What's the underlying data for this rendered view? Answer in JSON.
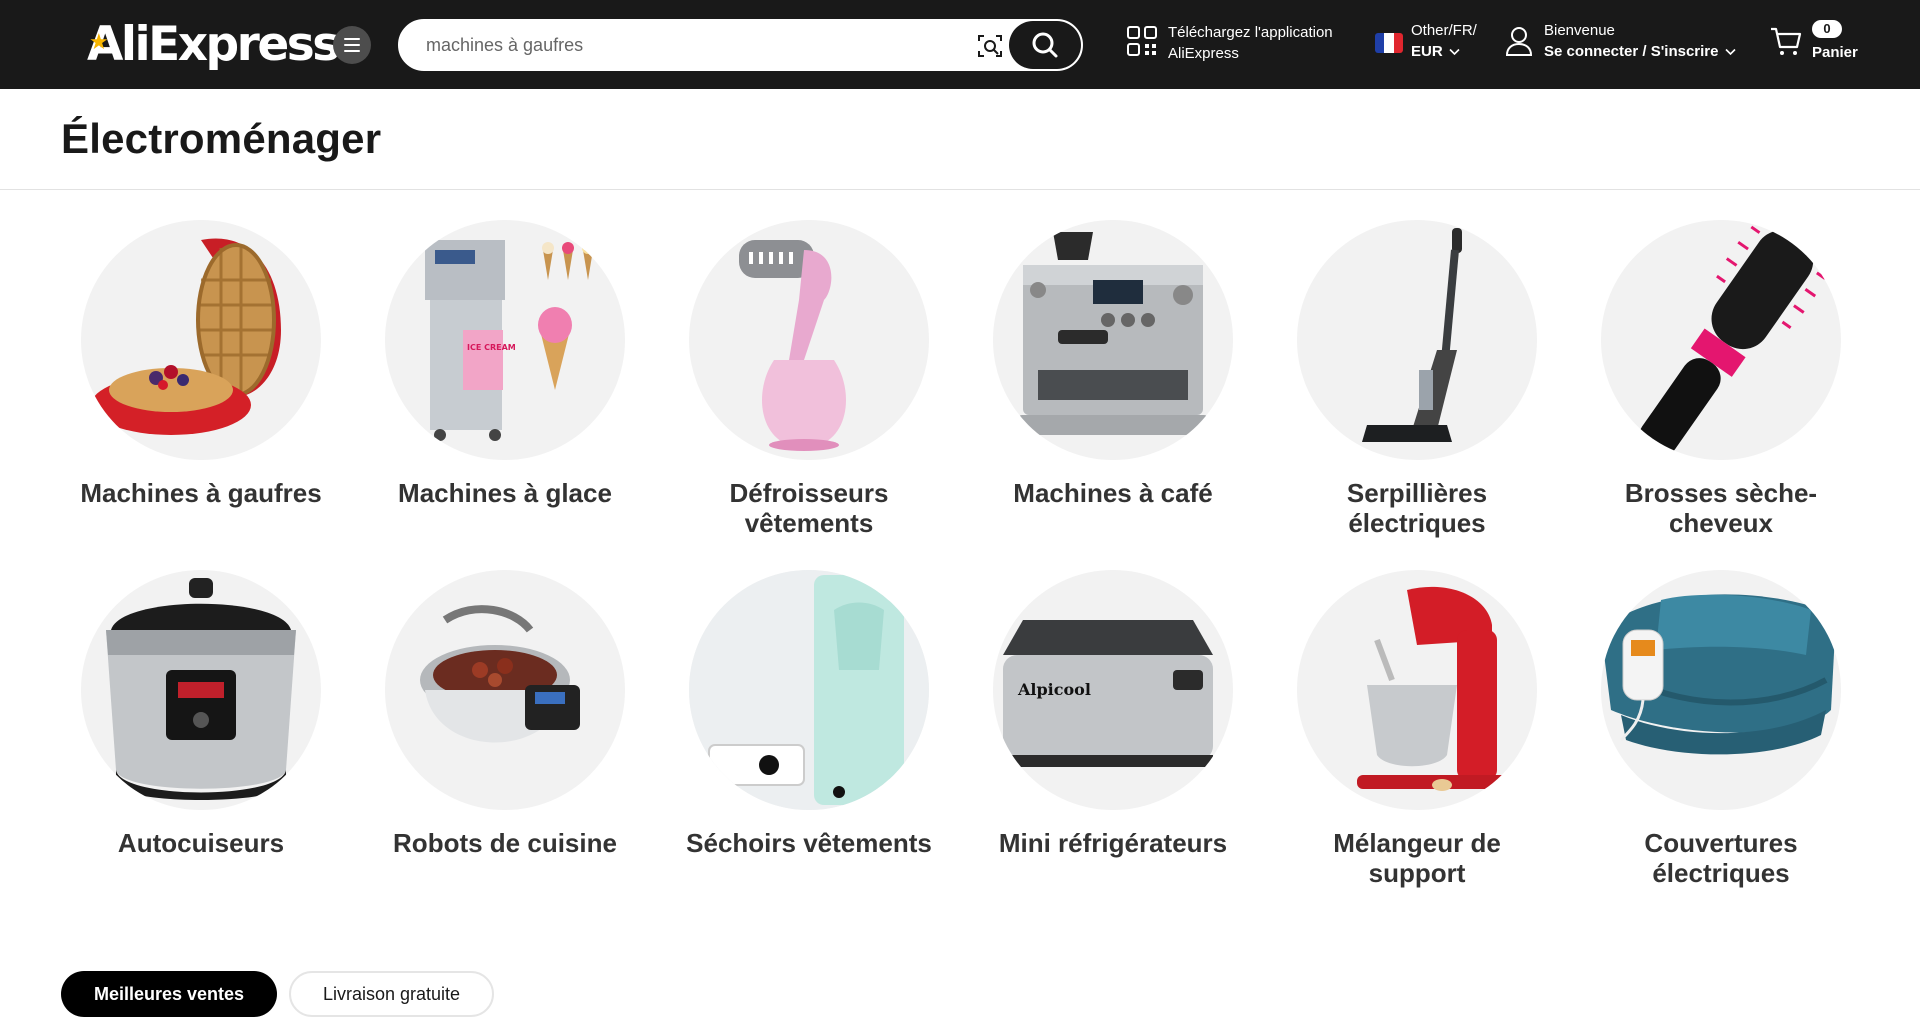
{
  "header": {
    "logo_text": "AliExpress",
    "search": {
      "value": "machines à gaufres",
      "placeholder": ""
    },
    "app_download": {
      "line1": "Téléchargez l'application",
      "line2": "AliExpress"
    },
    "region": {
      "line1": "Other/FR/",
      "currency": "EUR"
    },
    "account": {
      "greeting": "Bienvenue",
      "action": "Se connecter / S'inscrire"
    },
    "cart": {
      "count": "0",
      "label": "Panier"
    }
  },
  "page": {
    "title": "Électroménager"
  },
  "categories": [
    {
      "label": "Machines à gaufres",
      "icon": "waffle-maker"
    },
    {
      "label": "Machines à glace",
      "icon": "ice-cream-machine"
    },
    {
      "label": "Défroisseurs vêtements",
      "icon": "garment-steamer"
    },
    {
      "label": "Machines à café",
      "icon": "espresso-machine"
    },
    {
      "label": "Serpillières électriques",
      "icon": "electric-mop"
    },
    {
      "label": "Brosses sèche-cheveux",
      "icon": "hair-dryer-brush"
    },
    {
      "label": "Autocuiseurs",
      "icon": "pressure-cooker"
    },
    {
      "label": "Robots de cuisine",
      "icon": "cooking-robot"
    },
    {
      "label": "Séchoirs vêtements",
      "icon": "clothes-dryer"
    },
    {
      "label": "Mini réfrigérateurs",
      "icon": "mini-fridge"
    },
    {
      "label": "Mélangeur de support",
      "icon": "stand-mixer"
    },
    {
      "label": "Couvertures électriques",
      "icon": "electric-blanket"
    }
  ],
  "filters": [
    {
      "label": "Meilleures ventes",
      "active": true
    },
    {
      "label": "Livraison gratuite",
      "active": false
    }
  ]
}
